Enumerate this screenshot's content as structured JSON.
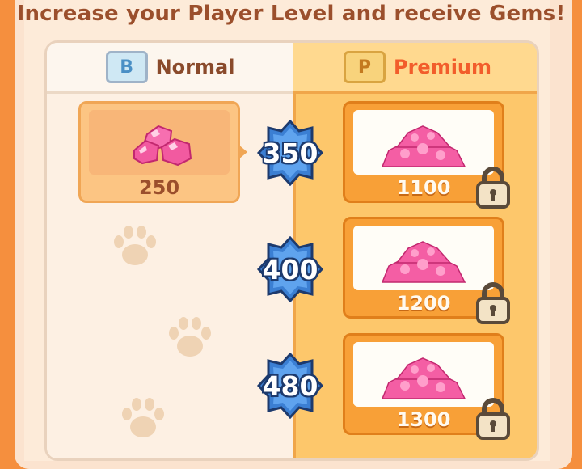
{
  "subtitle": "Increase your Player Level and receive Gems!",
  "tabs": {
    "normal": {
      "label": "Normal",
      "ticket_letter": "B"
    },
    "premium": {
      "label": "Premium",
      "ticket_letter": "P"
    }
  },
  "rewards": [
    {
      "level": "350",
      "normal_amount": "250",
      "premium_amount": "1100",
      "premium_locked": true
    },
    {
      "level": "400",
      "premium_amount": "1200",
      "premium_locked": true
    },
    {
      "level": "480",
      "premium_amount": "1300",
      "premium_locked": true
    }
  ],
  "colors": {
    "background": "#f58f3e",
    "premium_column": "#fdc76b",
    "normal_column": "#fdf0e3",
    "gem": "#f25aa0",
    "level_badge": "#3b7fd3"
  },
  "icons": [
    "ticket-b-icon",
    "ticket-p-icon",
    "gem-icon",
    "gem-pile-icon",
    "lock-icon",
    "paw-print-icon",
    "level-badge-icon"
  ]
}
